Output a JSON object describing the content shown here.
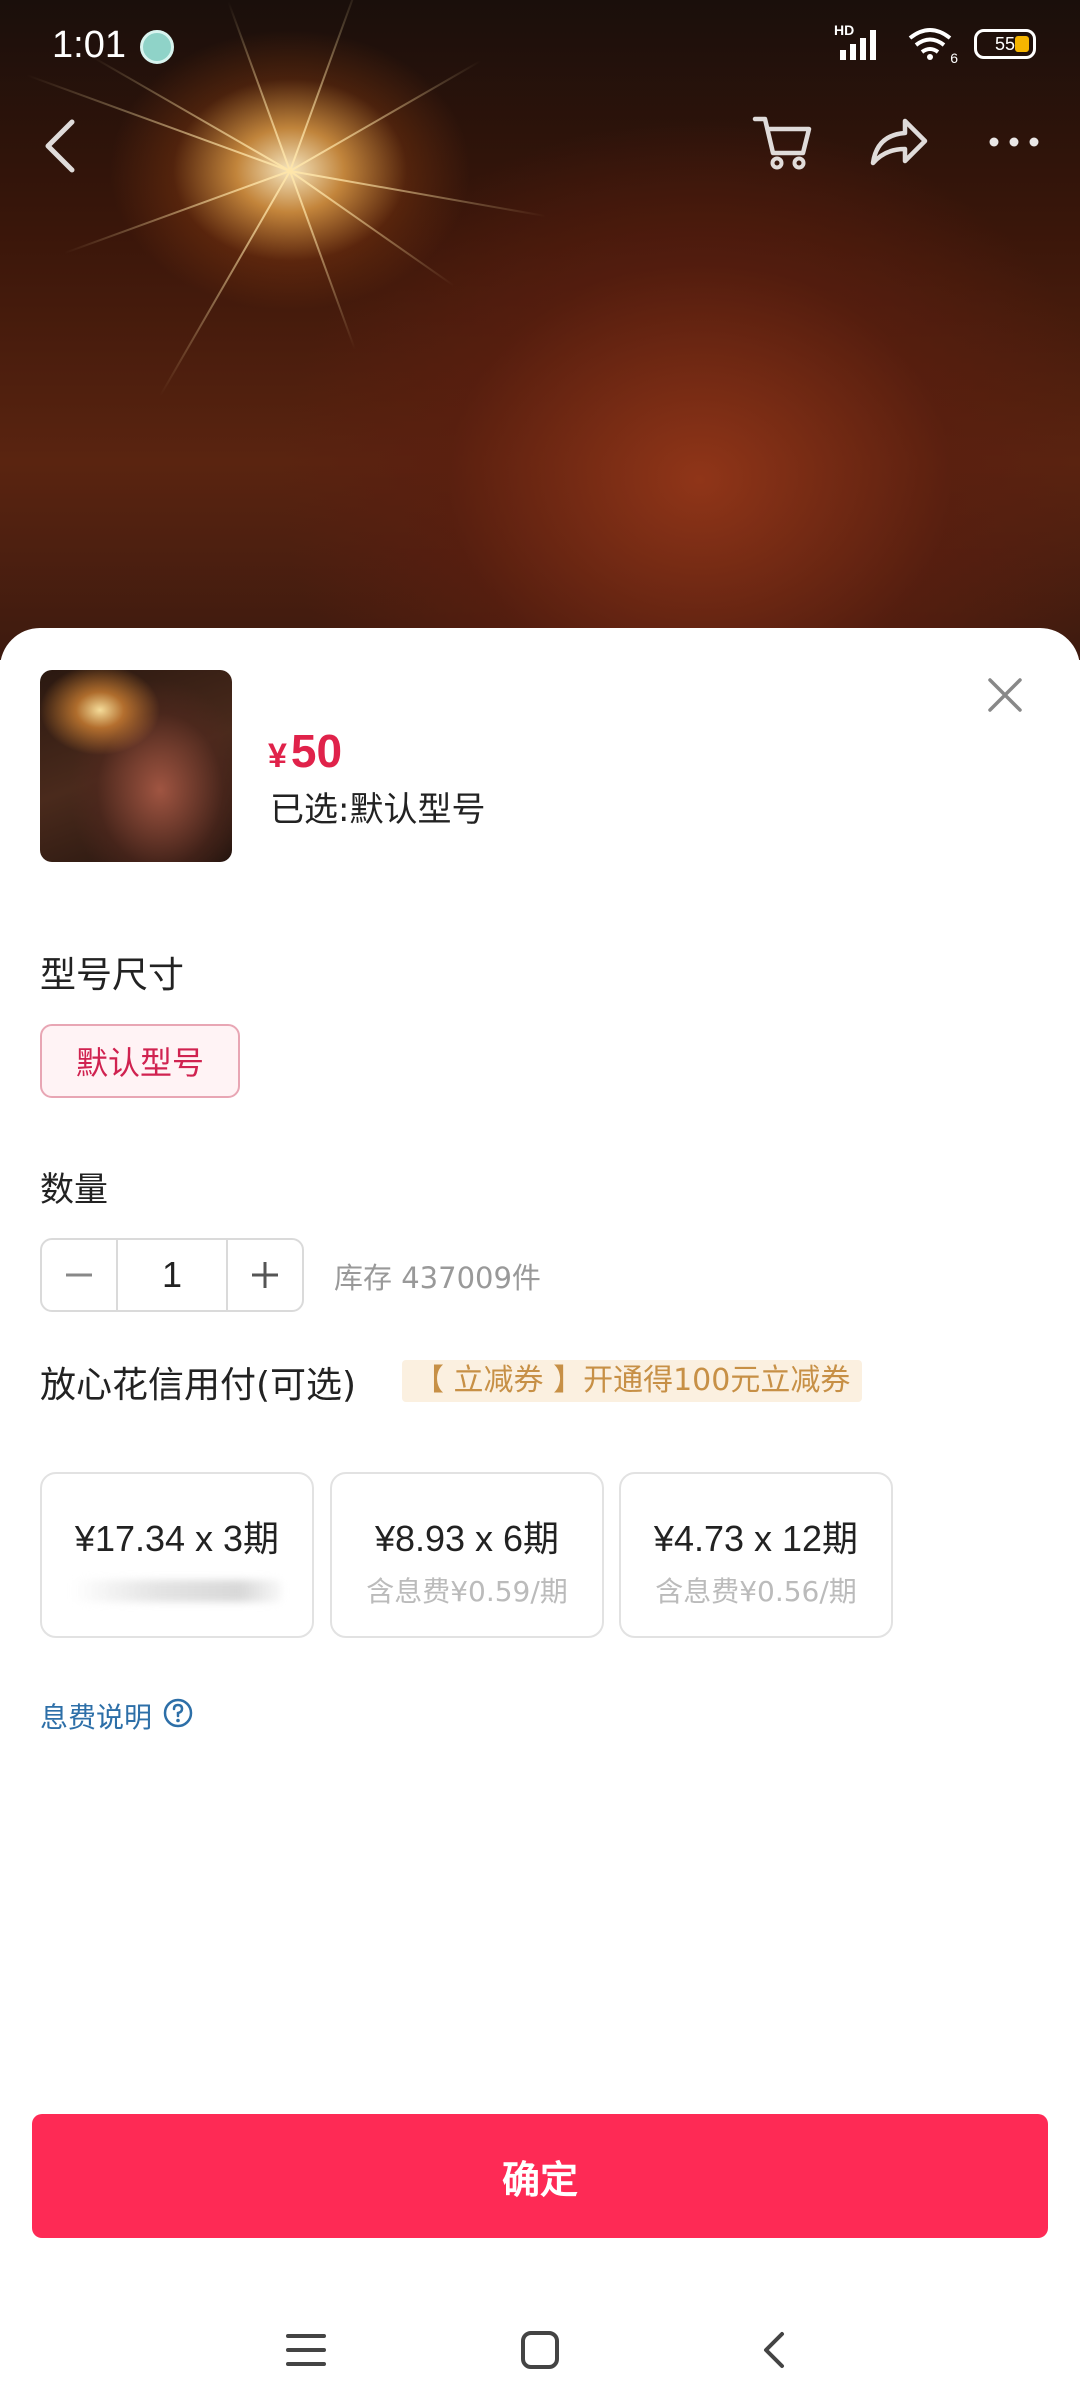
{
  "status_bar": {
    "time": "1:01",
    "network": "HD",
    "wifi_sub": "6",
    "battery": "55",
    "icons": [
      "app-icon",
      "signal-icon",
      "wifi-icon",
      "battery-icon"
    ]
  },
  "top_nav": {
    "icons": [
      "back-icon",
      "cart-icon",
      "share-icon",
      "more-icon"
    ]
  },
  "product": {
    "currency": "¥",
    "price": "50",
    "selected": "已选:默认型号"
  },
  "spec": {
    "label": "型号尺寸",
    "options": [
      "默认型号"
    ]
  },
  "quantity": {
    "label": "数量",
    "value": "1",
    "stock": "库存 437009件"
  },
  "credit": {
    "label": "放心花信用付(可选)",
    "promo": "【 立减券 】开通得100元立减券",
    "plans": [
      {
        "main": "¥17.34 x 3期",
        "sub": ""
      },
      {
        "main": "¥8.93 x 6期",
        "sub": "含息费¥0.59/期"
      },
      {
        "main": "¥4.73 x 12期",
        "sub": "含息费¥0.56/期"
      }
    ],
    "fee_note": "息费说明"
  },
  "confirm_label": "确定",
  "system_nav": [
    "menu-icon",
    "home-icon",
    "back-icon"
  ],
  "colors": {
    "accent": "#fe2a55",
    "price": "#e0224a",
    "promo_bg": "#fbf0e0",
    "promo_text": "#c79046",
    "link": "#2d6fa8"
  }
}
